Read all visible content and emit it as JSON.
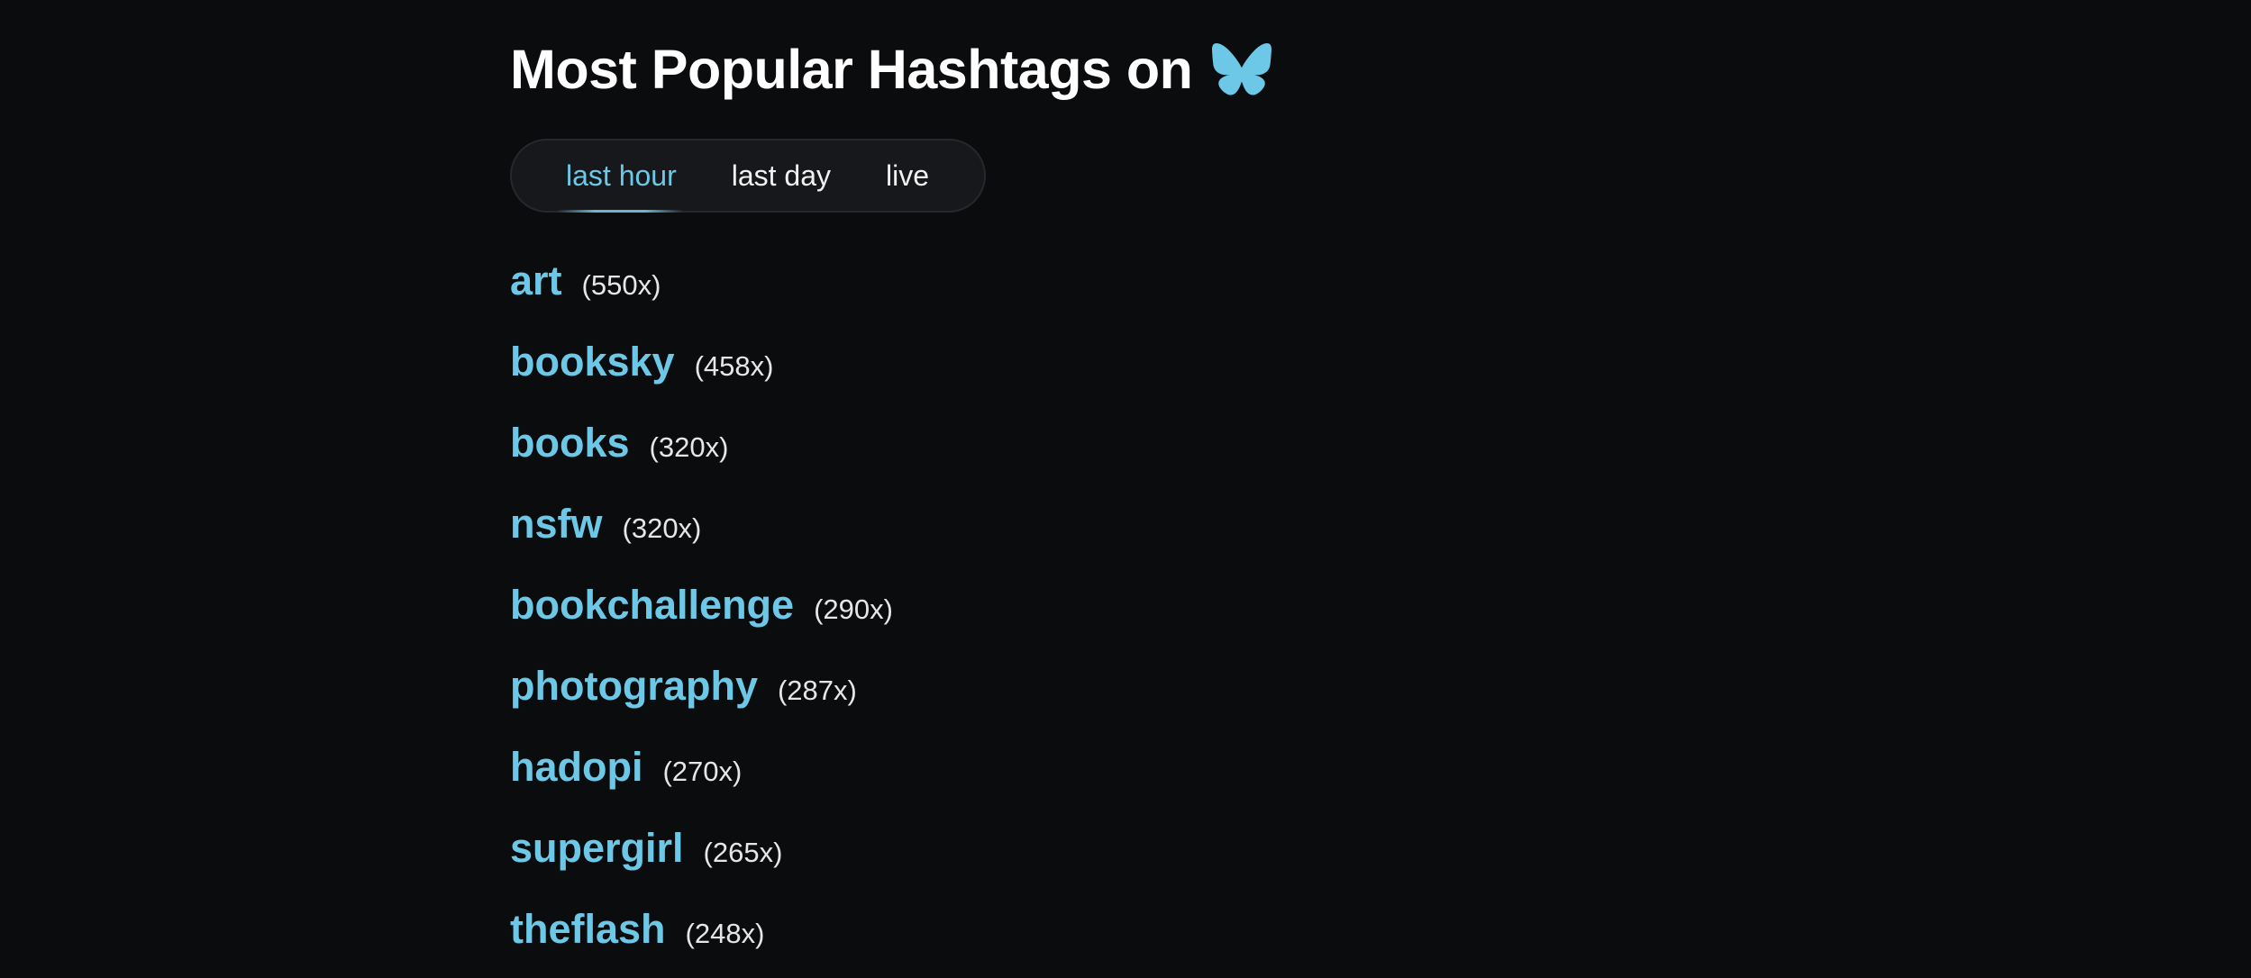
{
  "page": {
    "title": "Most Popular Hashtags on"
  },
  "logo": {
    "icon": "butterfly-icon",
    "color": "#6cc8e6"
  },
  "tabs": [
    {
      "label": "last hour",
      "active": true
    },
    {
      "label": "last day",
      "active": false
    },
    {
      "label": "live",
      "active": false
    }
  ],
  "hashtags": [
    {
      "name": "art",
      "count": "(550x)"
    },
    {
      "name": "booksky",
      "count": "(458x)"
    },
    {
      "name": "books",
      "count": "(320x)"
    },
    {
      "name": "nsfw",
      "count": "(320x)"
    },
    {
      "name": "bookchallenge",
      "count": "(290x)"
    },
    {
      "name": "photography",
      "count": "(287x)"
    },
    {
      "name": "hadopi",
      "count": "(270x)"
    },
    {
      "name": "supergirl",
      "count": "(265x)"
    },
    {
      "name": "theflash",
      "count": "(248x)"
    }
  ],
  "colors": {
    "background": "#0b0c0e",
    "accent": "#6cc8e6",
    "text": "#ffffff"
  }
}
